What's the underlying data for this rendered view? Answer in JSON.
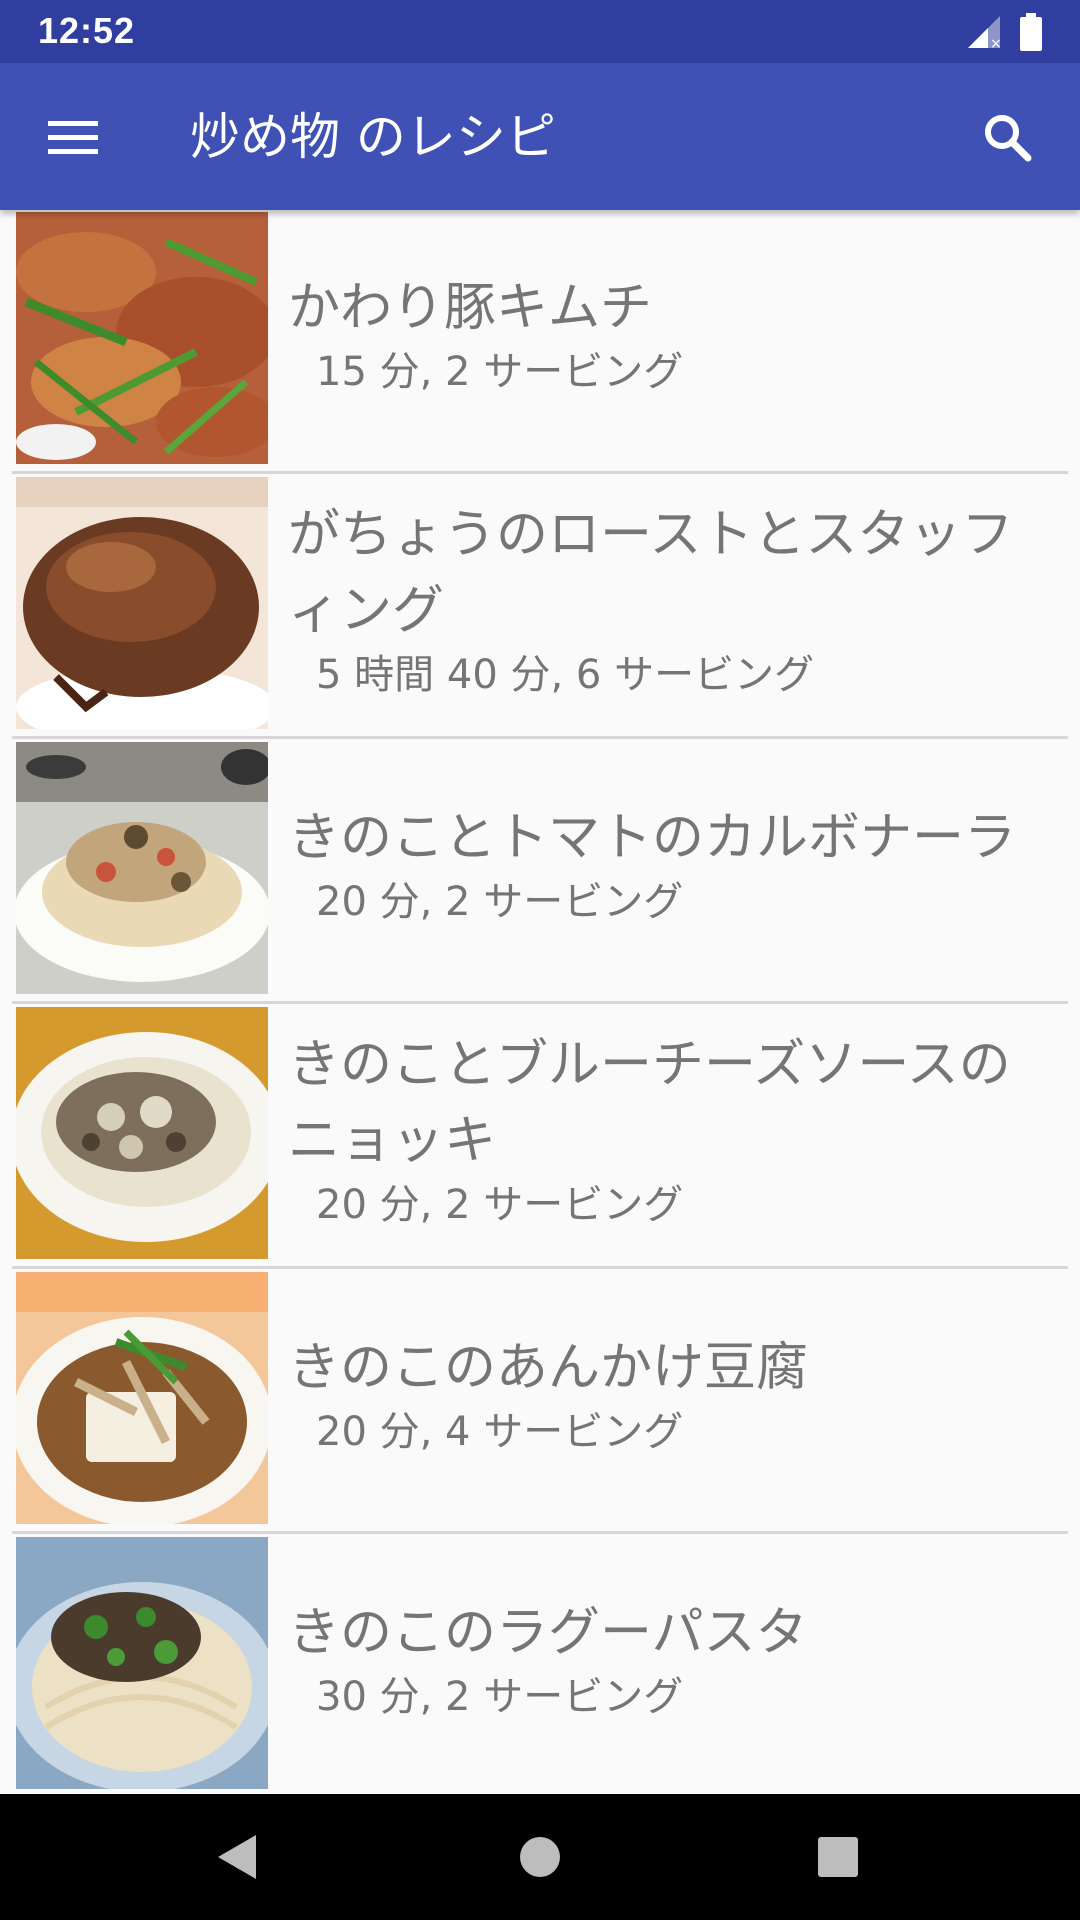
{
  "status_bar": {
    "time": "12:52",
    "icons": [
      "signal-off-icon",
      "battery-icon"
    ]
  },
  "app_bar": {
    "title": "炒め物 のレシピ",
    "menu_icon": "hamburger-menu-icon",
    "search_icon": "search-icon"
  },
  "recipes": [
    {
      "title": "かわり豚キムチ",
      "meta": "15 分, 2 サービング",
      "image": "pork-kimchi-photo"
    },
    {
      "title": "がちょうのローストとスタッフィング",
      "meta": "5 時間 40 分, 6 サービング",
      "image": "roast-goose-photo"
    },
    {
      "title": "きのことトマトのカルボナーラ",
      "meta": "20 分, 2 サービング",
      "image": "mushroom-carbonara-photo"
    },
    {
      "title": "きのことブルーチーズソースのニョッキ",
      "meta": "20 分, 2 サービング",
      "image": "mushroom-gnocchi-photo"
    },
    {
      "title": "きのこのあんかけ豆腐",
      "meta": "20 分, 4 サービング",
      "image": "mushroom-tofu-photo"
    },
    {
      "title": "きのこのラグーパスタ",
      "meta": "30 分, 2 サービング",
      "image": "mushroom-ragu-pasta-photo"
    }
  ],
  "nav_bar": {
    "back_icon": "back-triangle-icon",
    "home_icon": "home-circle-icon",
    "recents_icon": "recents-square-icon"
  }
}
